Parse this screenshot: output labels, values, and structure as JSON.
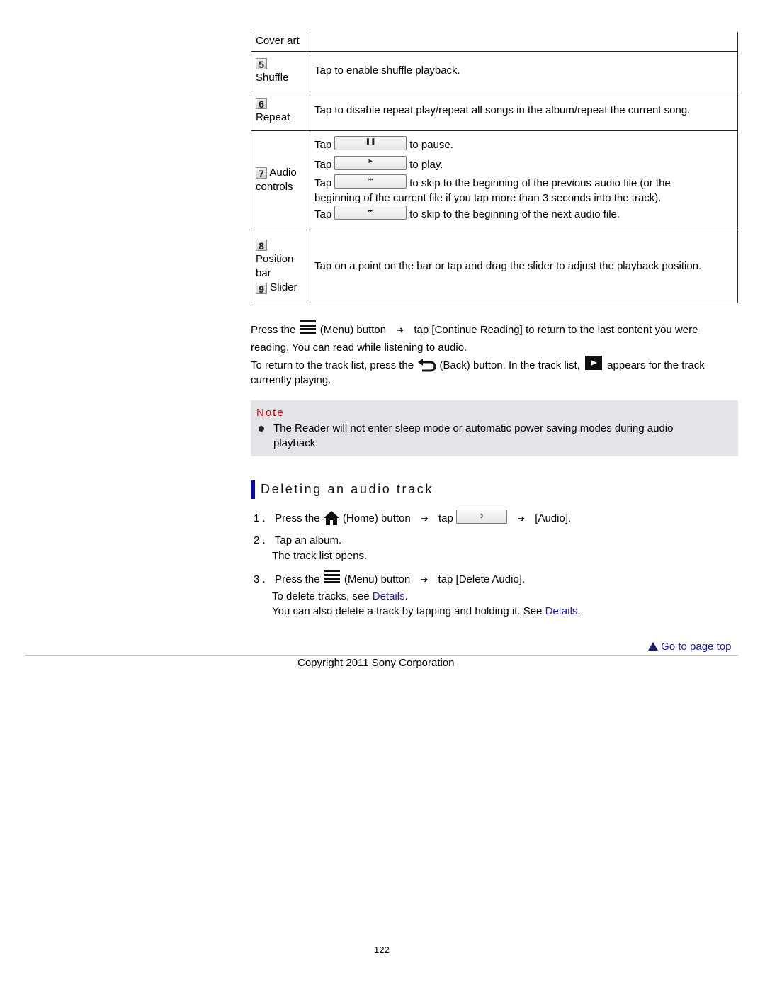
{
  "table": {
    "rows": [
      {
        "label": "Cover art",
        "desc": ""
      },
      {
        "num": "5",
        "label": "Shuffle",
        "desc": "Tap to enable shuffle playback."
      },
      {
        "num": "6",
        "label": "Repeat",
        "desc": "Tap to disable repeat play/repeat all songs in the album/repeat the current song."
      },
      {
        "num": "7",
        "label1": "Audio",
        "label2": "controls",
        "controls": [
          {
            "tap": "Tap",
            "icon": "pause-icon",
            "glyph": "❚❚",
            "desc": "to pause."
          },
          {
            "tap": "Tap",
            "icon": "play-icon",
            "glyph": "►",
            "desc": "to play."
          },
          {
            "tap": "Tap",
            "icon": "previous-track-icon",
            "glyph": "⏮",
            "desc": "to skip to the beginning of the previous audio file (or the",
            "desc2": "beginning of the current file if you tap more than 3 seconds into the track)."
          },
          {
            "tap": "Tap",
            "icon": "next-track-icon",
            "glyph": "⏭",
            "desc": "to skip to the beginning of the next audio file."
          }
        ]
      },
      {
        "num": "8",
        "label": "Position bar",
        "num2": "9",
        "label2": "Slider",
        "desc": "Tap on a point on the bar or tap and drag the slider to adjust the playback position."
      }
    ]
  },
  "paragraphs": {
    "p1_a": "Press the",
    "p1_b": "(Menu) button",
    "p1_c": "tap [Continue Reading] to return to the last content you were",
    "p1_d": "reading. You can read while listening to audio.",
    "p2_a": "To return to the track list, press the",
    "p2_b": "(Back) button. In the track list,",
    "p2_c": "appears for the track",
    "p2_d": "currently playing."
  },
  "note": {
    "title": "Note",
    "text": "The Reader will not enter sleep mode or automatic power saving modes during audio playback."
  },
  "section": {
    "heading": "Deleting an audio track",
    "steps": [
      {
        "n": "1 .",
        "a": "Press the",
        "b": "(Home) button",
        "c": "tap",
        "d": "[Audio]."
      },
      {
        "n": "2 .",
        "a": "Tap an album.",
        "sub": "The track list opens."
      },
      {
        "n": "3 .",
        "a": "Press the",
        "b": "(Menu) button",
        "c": "tap [Delete Audio].",
        "sub1": "To delete tracks, see",
        "sub1_link": "Details",
        "sub2": "You can also delete a track by tapping and holding it. See",
        "sub2_link": "Details"
      }
    ]
  },
  "footer": {
    "go_top": "Go to page top",
    "copyright": "Copyright 2011 Sony Corporation",
    "page_number": "122"
  },
  "colors": {
    "link": "#1a1ab0",
    "note_title": "#cc0000",
    "heading_bar": "#0a0aa0",
    "note_bg": "#e3e4e8"
  }
}
